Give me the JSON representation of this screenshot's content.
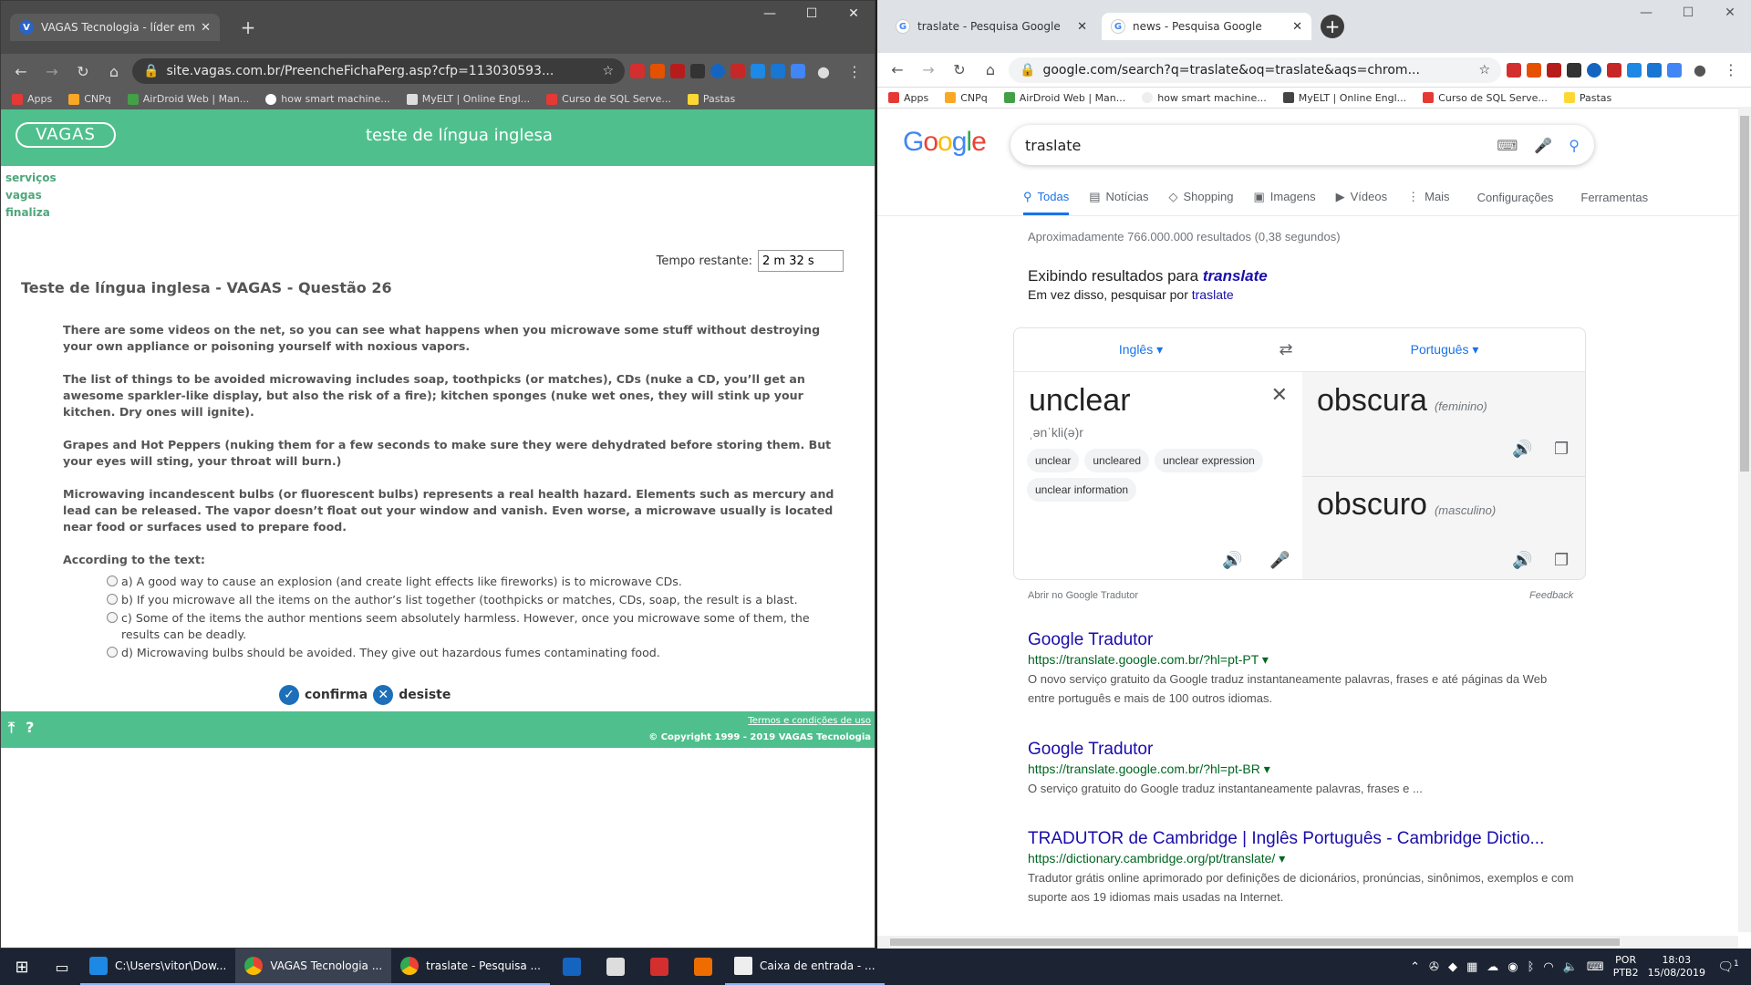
{
  "left_browser": {
    "tab": {
      "title": "VAGAS Tecnologia - líder em solu",
      "close": "✕"
    },
    "url": "site.vagas.com.br/PreencheFichaPerg.asp?cfp=113030593...",
    "bookmarks": [
      "Apps",
      "CNPq",
      "AirDroid Web | Man...",
      "how smart machine...",
      "MyELT | Online Engl...",
      "Curso de SQL Serve...",
      "Pastas"
    ],
    "page": {
      "logo": "VAGAS",
      "header_title": "teste de língua inglesa",
      "menu": [
        "serviços",
        "vagas",
        "finaliza"
      ],
      "timer_label": "Tempo restante:",
      "timer_value": "2 m 32 s",
      "question_title": "Teste de língua inglesa - VAGAS - Questão 26",
      "paragraphs": [
        "There are some videos on the net, so you can see what happens when you microwave some stuff without destroying your own appliance or poisoning yourself with noxious vapors.",
        "The list of things to be avoided microwaving includes soap, toothpicks (or matches), CDs (nuke a CD, you’ll get an awesome sparkler-like display, but also the risk of a fire); kitchen sponges (nuke wet ones, they will stink up your kitchen. Dry ones will ignite).",
        "Grapes and Hot Peppers (nuking them for a few seconds to make sure they were dehydrated before storing them. But your eyes will sting, your throat will burn.)",
        "Microwaving incandescent bulbs (or fluorescent bulbs) represents a real health hazard. Elements such as mercury and lead can be released. The vapor doesn’t float out your window and vanish. Even worse, a microwave usually is located near food or surfaces used to prepare food.",
        "According to the text:"
      ],
      "options": [
        "a) A good way to cause an explosion (and create light effects like fireworks) is to microwave CDs.",
        "b) If you microwave all the items on the author’s list together (toothpicks or matches, CDs, soap, the result is a blast.",
        "c) Some of the items the author mentions seem absolutely harmless. However, once you microwave some of them, the results can be deadly.",
        "d) Microwaving bulbs should be avoided. They give out hazardous fumes contaminating food."
      ],
      "confirm_label": "confirma",
      "quit_label": "desiste",
      "terms_link": "Termos e condições de uso",
      "copyright": "© Copyright 1999 - 2019 VAGAS Tecnologia"
    }
  },
  "right_browser": {
    "tabs": [
      {
        "title": "traslate - Pesquisa Google",
        "close": "✕"
      },
      {
        "title": "news - Pesquisa Google",
        "close": "✕"
      }
    ],
    "url": "google.com/search?q=traslate&oq=traslate&aqs=chrom...",
    "bookmarks": [
      "Apps",
      "CNPq",
      "AirDroid Web | Man...",
      "how smart machine...",
      "MyELT | Online Engl...",
      "Curso de SQL Serve...",
      "Pastas"
    ],
    "search_query": "traslate",
    "nav_tabs": [
      "Todas",
      "Notícias",
      "Shopping",
      "Imagens",
      "Vídeos",
      "Mais",
      "Configurações",
      "Ferramentas"
    ],
    "stats": "Aproximadamente 766.000.000 resultados (0,38 segundos)",
    "showing_prefix": "Exibindo resultados para",
    "showing_term": "translate",
    "instead_prefix": "Em vez disso, pesquisar por",
    "instead_term": "traslate",
    "translator": {
      "source_lang": "Inglês",
      "target_lang": "Português",
      "source_word": "unclear",
      "phonetic": "ˌənˈkli(ə)r",
      "chips": [
        "unclear",
        "uncleared",
        "unclear expression",
        "unclear information"
      ],
      "result1": "obscura",
      "result1_gender": "(feminino)",
      "result2": "obscuro",
      "result2_gender": "(masculino)",
      "open_link": "Abrir no Google Tradutor",
      "feedback": "Feedback"
    },
    "results": [
      {
        "title": "Google Tradutor",
        "url": "https://translate.google.com.br/?hl=pt-PT ▾",
        "desc": "O novo serviço gratuito da Google traduz instantaneamente palavras, frases e até páginas da Web entre português e mais de 100 outros idiomas."
      },
      {
        "title": "Google Tradutor",
        "url": "https://translate.google.com.br/?hl=pt-BR ▾",
        "desc": "O serviço gratuito do Google traduz instantaneamente palavras, frases e ..."
      },
      {
        "title": "TRADUTOR de Cambridge | Inglês Português - Cambridge Dictio...",
        "url": "https://dictionary.cambridge.org/pt/translate/ ▾",
        "desc": "Tradutor grátis online aprimorado por definições de dicionários, pronúncias, sinônimos, exemplos e com suporte aos 19 idiomas mais usadas na Internet."
      }
    ]
  },
  "taskbar": {
    "apps": [
      {
        "label": "C:\\Users\\vitor\\Dow..."
      },
      {
        "label": "VAGAS Tecnologia ..."
      },
      {
        "label": "traslate - Pesquisa ..."
      },
      {
        "label": "Caixa de entrada - ..."
      }
    ],
    "lang": "POR",
    "lang2": "PTB2",
    "time": "18:03",
    "date": "15/08/2019",
    "notif_count": "1"
  }
}
